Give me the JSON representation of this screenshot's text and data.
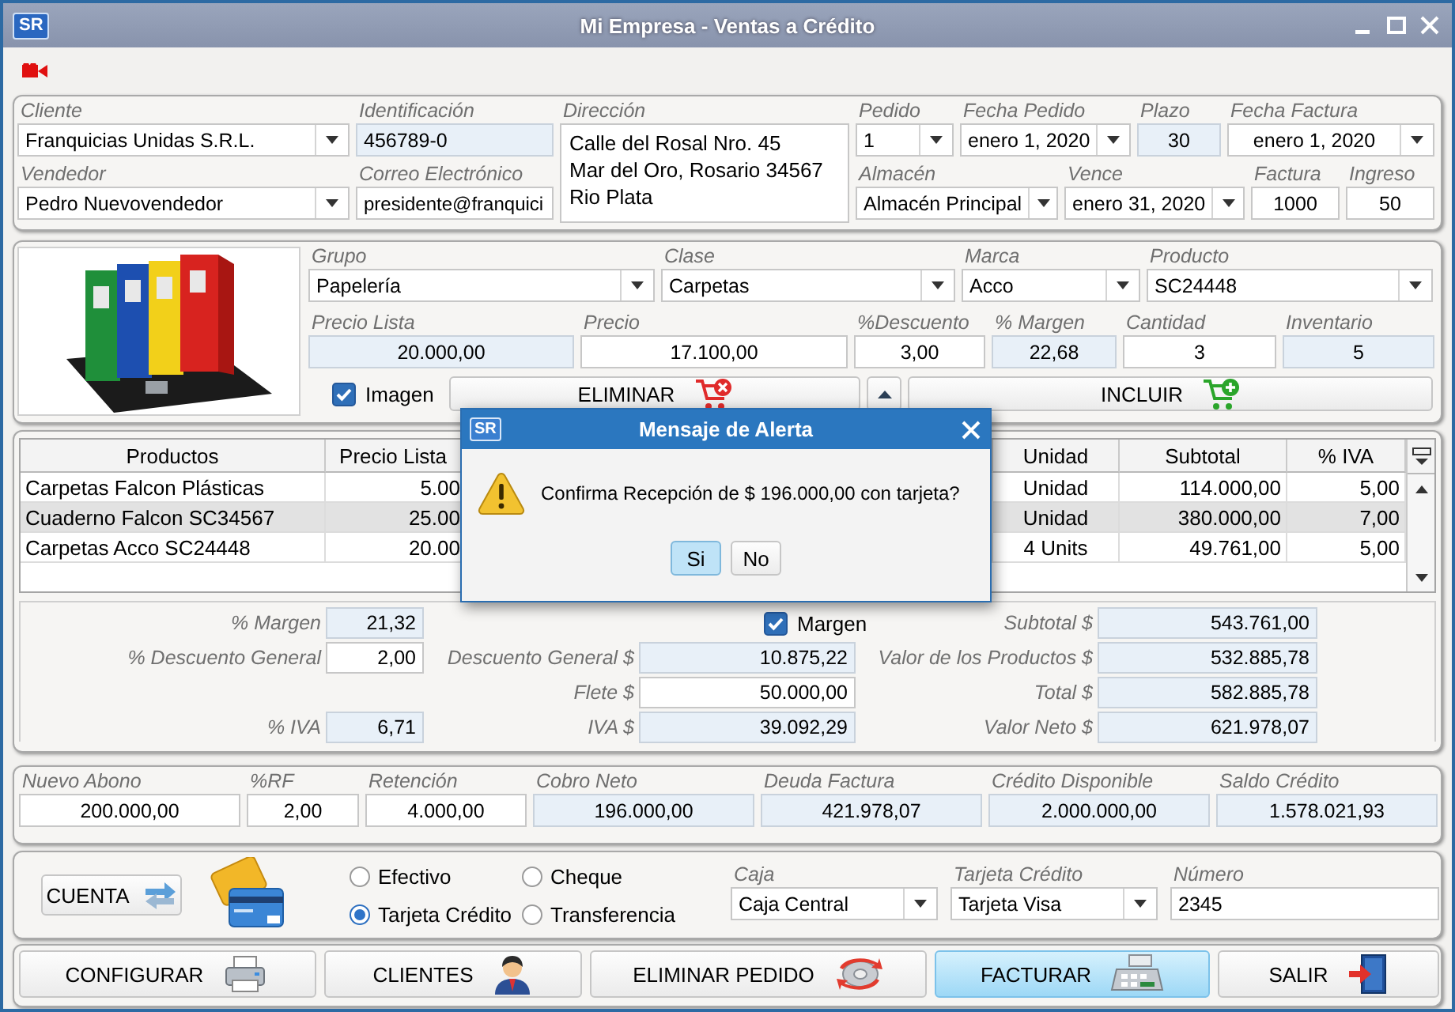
{
  "window": {
    "logo": "SR",
    "title": "Mi Empresa - Ventas a Crédito"
  },
  "header": {
    "customer": [
      {
        "label": "Cliente",
        "value": "Franquicias Unidas S.R.L.",
        "kind": "combo"
      },
      {
        "label": "Identificación",
        "value": "456789-0",
        "kind": "readonly"
      },
      {
        "label": "Vendedor",
        "value": "Pedro Nuevovendedor",
        "kind": "combo"
      },
      {
        "label": "Correo Electrónico",
        "value": "presidente@franquici",
        "kind": "input"
      }
    ],
    "address": {
      "label": "Dirección",
      "lines": [
        "Calle del Rosal Nro. 45",
        "Mar del Oro, Rosario 34567",
        "Rio Plata"
      ]
    },
    "order": [
      {
        "label": "Pedido",
        "value": "1",
        "kind": "combo"
      },
      {
        "label": "Fecha Pedido",
        "value": "enero 1, 2020",
        "kind": "combo"
      },
      {
        "label": "Plazo",
        "value": "30",
        "kind": "readonly"
      },
      {
        "label": "Fecha Factura",
        "value": "enero 1, 2020",
        "kind": "combo"
      },
      {
        "label": "Almacén",
        "value": "Almacén Principal",
        "kind": "combo"
      },
      {
        "label": "Vence",
        "value": "enero 31, 2020",
        "kind": "combo"
      },
      {
        "label": "Factura",
        "value": "1000",
        "kind": "input"
      },
      {
        "label": "Ingreso",
        "value": "50",
        "kind": "input"
      }
    ]
  },
  "product": {
    "fields": [
      {
        "label": "Grupo",
        "value": "Papelería",
        "kind": "combo"
      },
      {
        "label": "Clase",
        "value": "Carpetas",
        "kind": "combo"
      },
      {
        "label": "Marca",
        "value": "Acco",
        "kind": "combo"
      },
      {
        "label": "Producto",
        "value": "SC24448",
        "kind": "combo"
      },
      {
        "label": "Precio Lista",
        "value": "20.000,00",
        "kind": "readonly"
      },
      {
        "label": "Precio",
        "value": "17.100,00",
        "kind": "input"
      },
      {
        "label": "%Descuento",
        "value": "3,00",
        "kind": "input"
      },
      {
        "label": "% Margen",
        "value": "22,68",
        "kind": "readonly"
      },
      {
        "label": "Cantidad",
        "value": "3",
        "kind": "input"
      },
      {
        "label": "Inventario",
        "value": "5",
        "kind": "readonly"
      }
    ],
    "image_checkbox": {
      "label": "Imagen",
      "checked": true
    },
    "buttons": [
      {
        "label": "ELIMINAR",
        "kind": "remove"
      },
      {
        "label": "INCLUIR",
        "kind": "add"
      }
    ]
  },
  "table": {
    "columns": [
      "Productos",
      "Precio Lista",
      "Unidad",
      "Subtotal",
      "% IVA"
    ],
    "rows": [
      {
        "cells": [
          "Carpetas Falcon Plásticas",
          "5.00",
          "Unidad",
          "114.000,00",
          "5,00"
        ],
        "selected": false
      },
      {
        "cells": [
          "Cuaderno Falcon SC34567",
          "25.00",
          "Unidad",
          "380.000,00",
          "7,00"
        ],
        "selected": true
      },
      {
        "cells": [
          "Carpetas Acco SC24448",
          "20.00",
          "4 Units",
          "49.761,00",
          "5,00"
        ],
        "selected": false
      }
    ]
  },
  "summary": {
    "left": [
      {
        "label": "% Margen",
        "value": "21,32",
        "kind": "readonly"
      },
      {
        "label": "% Descuento General",
        "value": "2,00",
        "kind": "input"
      },
      {
        "label": "% IVA",
        "value": "6,71",
        "kind": "readonly"
      }
    ],
    "middle": [
      {
        "label": "Margen",
        "checked": true,
        "kind": "checkbox"
      },
      {
        "label": "Descuento General $",
        "value": "10.875,22",
        "kind": "readonly"
      },
      {
        "label": "Flete $",
        "value": "50.000,00",
        "kind": "input"
      },
      {
        "label": "IVA $",
        "value": "39.092,29",
        "kind": "readonly"
      }
    ],
    "right": [
      {
        "label": "Subtotal $",
        "value": "543.761,00",
        "kind": "readonly"
      },
      {
        "label": "Valor de los Productos $",
        "value": "532.885,78",
        "kind": "readonly"
      },
      {
        "label": "Total $",
        "value": "582.885,78",
        "kind": "readonly"
      },
      {
        "label": "Valor Neto $",
        "value": "621.978,07",
        "kind": "readonly"
      }
    ]
  },
  "payment": [
    {
      "label": "Nuevo Abono",
      "value": "200.000,00",
      "kind": "input"
    },
    {
      "label": "%RF",
      "value": "2,00",
      "kind": "input"
    },
    {
      "label": "Retención",
      "value": "4.000,00",
      "kind": "input"
    },
    {
      "label": "Cobro Neto",
      "value": "196.000,00",
      "kind": "readonly"
    },
    {
      "label": "Deuda Factura",
      "value": "421.978,07",
      "kind": "readonly"
    },
    {
      "label": "Crédito Disponible",
      "value": "2.000.000,00",
      "kind": "readonly"
    },
    {
      "label": "Saldo Crédito",
      "value": "1.578.021,93",
      "kind": "readonly"
    }
  ],
  "payment_method": {
    "account_button": "CUENTA",
    "options": [
      {
        "label": "Efectivo",
        "selected": false
      },
      {
        "label": "Cheque",
        "selected": false
      },
      {
        "label": "Tarjeta Crédito",
        "selected": true
      },
      {
        "label": "Transferencia",
        "selected": false
      }
    ],
    "fields": [
      {
        "label": "Caja",
        "value": "Caja Central",
        "kind": "combo"
      },
      {
        "label": "Tarjeta Crédito",
        "value": "Tarjeta Visa",
        "kind": "combo"
      },
      {
        "label": "Número",
        "value": "2345",
        "kind": "input"
      }
    ]
  },
  "actions": [
    {
      "label": "CONFIGURAR",
      "kind": "configure",
      "selected": false
    },
    {
      "label": "CLIENTES",
      "kind": "clients",
      "selected": false
    },
    {
      "label": "ELIMINAR PEDIDO",
      "kind": "delete_order",
      "selected": false
    },
    {
      "label": "FACTURAR",
      "kind": "invoice",
      "selected": true
    },
    {
      "label": "SALIR",
      "kind": "exit",
      "selected": false
    }
  ],
  "dialog": {
    "logo": "SR",
    "title": "Mensaje de Alerta",
    "message": "Confirma Recepción de $ 196.000,00 con tarjeta?",
    "buttons": [
      {
        "label": "Si",
        "selected": true
      },
      {
        "label": "No",
        "selected": false
      }
    ]
  }
}
